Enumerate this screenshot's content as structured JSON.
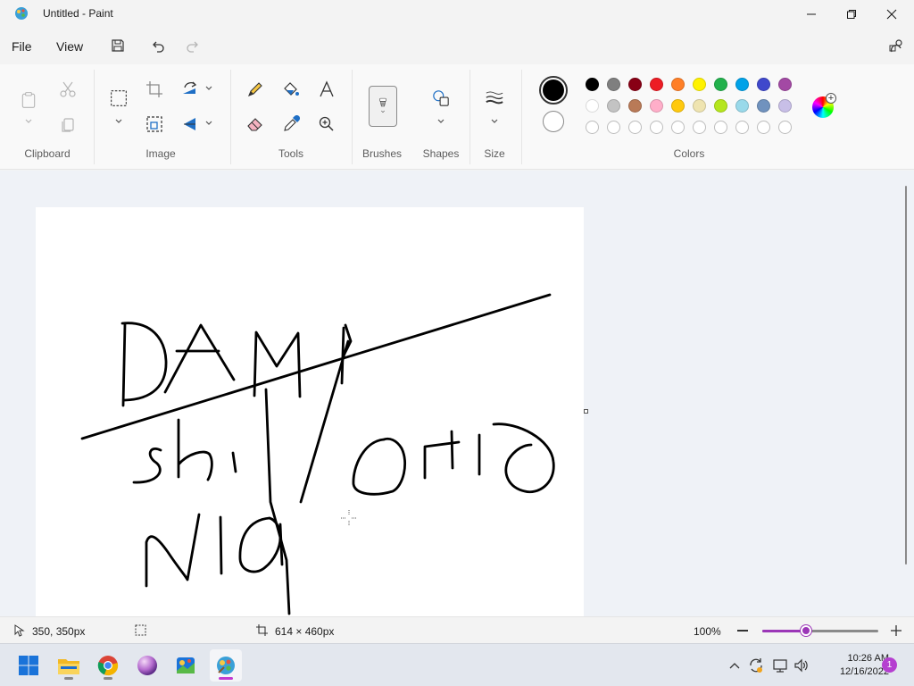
{
  "window": {
    "title": "Untitled - Paint",
    "minimize_icon": "minimize-icon",
    "maximize_icon": "restore-icon",
    "close_icon": "close-icon"
  },
  "menu": {
    "file": "File",
    "view": "View",
    "save_icon": "save-icon",
    "undo_icon": "undo-icon",
    "redo_icon": "redo-icon",
    "share_icon": "share-icon"
  },
  "ribbon": {
    "groups": {
      "clipboard": "Clipboard",
      "image": "Image",
      "tools": "Tools",
      "brushes": "Brushes",
      "shapes": "Shapes",
      "size": "Size",
      "colors": "Colors"
    },
    "primary_color": "#000000",
    "secondary_color": "#ffffff",
    "palette_row1": [
      "#000000",
      "#7f7f7f",
      "#880015",
      "#ed1c24",
      "#ff7f27",
      "#fff200",
      "#22b14c",
      "#00a2e8",
      "#3f48cc",
      "#a349a4"
    ],
    "palette_row2": [
      "#ffffff",
      "#c3c3c3",
      "#b97a57",
      "#ffaec9",
      "#ffc90e",
      "#efe4b0",
      "#b5e61d",
      "#99d9ea",
      "#7092be",
      "#c8bfe7"
    ],
    "palette_row3_empty": 10
  },
  "status": {
    "cursor_position": "350, 350px",
    "canvas_size": "614 × 460px",
    "zoom": "100%",
    "zoom_level": 0.38
  },
  "taskbar": {
    "time": "10:26 AM",
    "date": "12/16/2022",
    "notification_count": "1",
    "apps": [
      "start-icon",
      "file-explorer-icon",
      "chrome-icon",
      "orb-app-icon",
      "photos-app-icon",
      "paint-icon"
    ]
  },
  "accent": "#9b36b7"
}
